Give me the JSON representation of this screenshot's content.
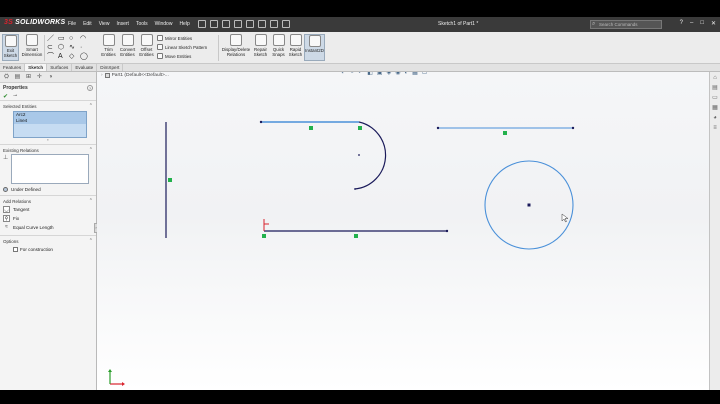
{
  "app": {
    "logo_prefix": "3S",
    "logo_name": "SOLIDWORKS",
    "document_title": "Sketch1 of Part1 *",
    "search_placeholder": "Search Commands"
  },
  "menu": [
    "File",
    "Edit",
    "View",
    "Insert",
    "Tools",
    "Window",
    "Help"
  ],
  "ribbon": {
    "exit_sketch": "Exit Sketch",
    "smart_dimension": "Smart Dimension",
    "trim_entities": "Trim Entities",
    "convert_entities": "Convert Entities",
    "offset_entities": "Offset Entities",
    "mirror_entities": "Mirror Entities",
    "linear_sketch_pattern": "Linear Sketch Pattern",
    "move_entities": "Move Entities",
    "display_delete_relations": "Display/Delete Relations",
    "repair_sketch": "Repair Sketch",
    "quick_snaps": "Quick Snaps",
    "rapid_sketch": "Rapid Sketch",
    "instant2d": "Instant2D"
  },
  "tabs": [
    "Features",
    "Sketch",
    "Surfaces",
    "Evaluate",
    "DimXpert"
  ],
  "active_tab": "Sketch",
  "breadcrumb": "Part1 (Default<<Default>...",
  "property_manager": {
    "title": "Properties",
    "selected_entities_title": "Selected Entities",
    "selected_entities": [
      "Arc2",
      "Line4"
    ],
    "existing_relations_title": "Existing Relations",
    "status": "Under Defined",
    "add_relations_title": "Add Relations",
    "relations": [
      "Tangent",
      "Fix",
      "Equal Curve Length"
    ],
    "options_title": "Options",
    "for_construction": "For construction"
  },
  "colors": {
    "sketch_defined": "#1a1a5a",
    "sketch_selected": "#4a90d9",
    "sketch_point": "#22b14c",
    "origin": "#d9232d"
  }
}
